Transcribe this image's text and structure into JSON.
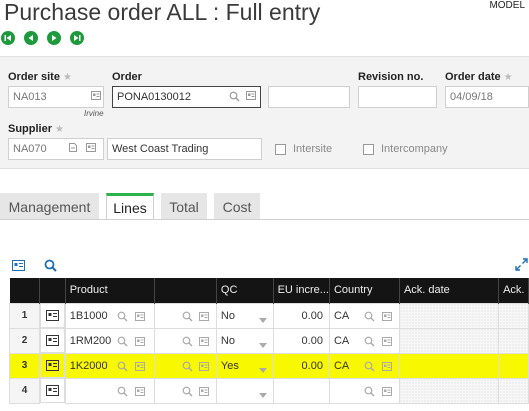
{
  "page": {
    "title": "Purchase order ALL : Full entry",
    "model_label": "MODEL"
  },
  "nav": {
    "first": "first-record",
    "previous": "previous-record",
    "next": "next-record",
    "last": "last-record"
  },
  "header": {
    "order_site": {
      "label": "Order site",
      "value": "NA013",
      "sublabel": "Irvine"
    },
    "order": {
      "label": "Order",
      "value": "PONA0130012"
    },
    "revision": {
      "label": "Revision no.",
      "value": ""
    },
    "order_date": {
      "label": "Order date",
      "value": "04/09/18"
    },
    "supplier": {
      "label": "Supplier",
      "value": "NA070",
      "name": "West Coast Trading"
    },
    "intersite": {
      "label": "Intersite",
      "checked": false
    },
    "intercompany": {
      "label": "Intercompany",
      "checked": false
    }
  },
  "tabs": [
    {
      "label": "Management",
      "active": false
    },
    {
      "label": "Lines",
      "active": true
    },
    {
      "label": "Total",
      "active": false
    },
    {
      "label": "Cost",
      "active": false
    }
  ],
  "grid": {
    "columns": [
      "",
      "",
      "Product",
      "",
      "QC",
      "EU incre...",
      "Country",
      "Ack. date",
      "Ack."
    ],
    "rows": [
      {
        "num": "1",
        "product": "1B1000",
        "qc": "No",
        "eu": "0.00",
        "country": "CA",
        "highlight": false
      },
      {
        "num": "2",
        "product": "1RM200",
        "qc": "No",
        "eu": "0.00",
        "country": "CA",
        "highlight": false
      },
      {
        "num": "3",
        "product": "1K2000",
        "qc": "Yes",
        "eu": "0.00",
        "country": "CA",
        "highlight": true
      },
      {
        "num": "4",
        "product": "",
        "qc": "",
        "eu": "",
        "country": "",
        "highlight": false
      }
    ]
  },
  "colors": {
    "accent_green": "#2bb34a",
    "nav_green": "#1e9a3c",
    "header_black": "#141414",
    "highlight_yellow": "#f8f800",
    "icon_blue": "#1e6fb5"
  }
}
